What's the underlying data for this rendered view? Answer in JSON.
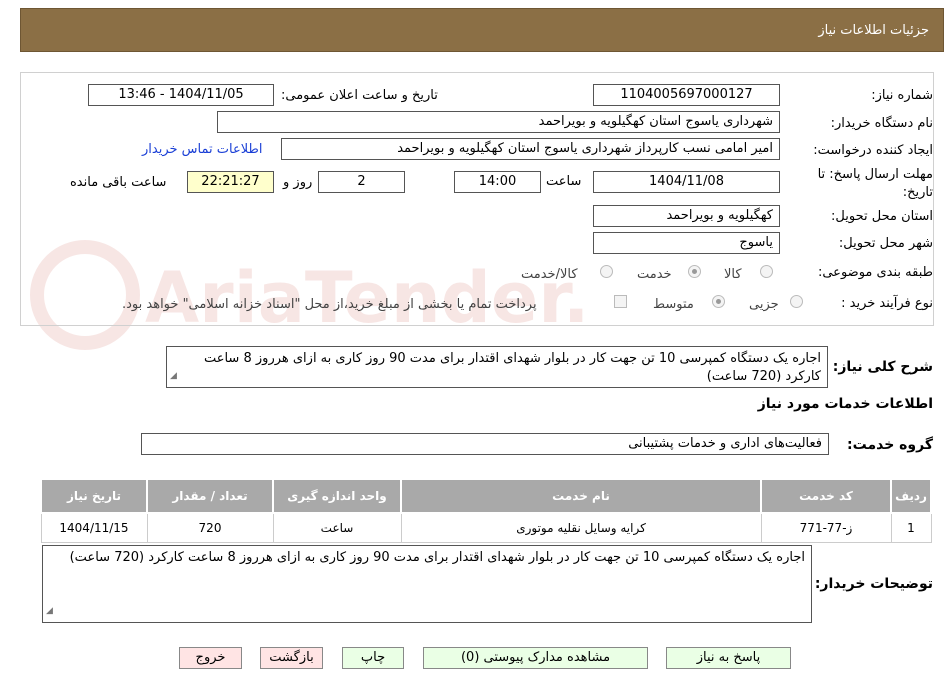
{
  "header": {
    "title": "جزئیات اطلاعات نیاز"
  },
  "watermark": "AriaTender.neT",
  "form": {
    "need_number_label": "شماره نیاز:",
    "need_number": "1104005697000127",
    "announce_label": "تاریخ و ساعت اعلان عمومی:",
    "announce_value": "1404/11/05 - 13:46",
    "buyer_org_label": "نام دستگاه خریدار:",
    "buyer_org": "شهرداری یاسوج استان کهگیلویه و بویراحمد",
    "creator_label": "ایجاد کننده درخواست:",
    "creator": "امیر امامی نسب کارپرداز شهرداری یاسوج استان کهگیلویه و بویراحمد",
    "contact_link": "اطلاعات تماس خریدار",
    "deadline_label_1": "مهلت ارسال پاسخ: تا",
    "deadline_label_2": "تاریخ:",
    "deadline_date": "1404/11/08",
    "hour_label": "ساعت",
    "deadline_hour": "14:00",
    "days_value": "2",
    "days_label": "روز و",
    "remaining_time": "22:21:27",
    "remaining_label": "ساعت باقی مانده",
    "province_label": "استان محل تحویل:",
    "province": "کهگیلویه و بویراحمد",
    "city_label": "شهر محل تحویل:",
    "city": "یاسوج",
    "category_label": "طبقه بندی موضوعی:",
    "category_options": [
      "کالا",
      "خدمت",
      "کالا/خدمت"
    ],
    "category_selected": "خدمت",
    "process_label": "نوع فرآیند خرید :",
    "process_options": [
      "جزیی",
      "متوسط"
    ],
    "process_selected": "متوسط",
    "payment_note": "پرداخت تمام یا بخشی از مبلغ خرید،از محل \"اسناد خزانه اسلامی\" خواهد بود."
  },
  "summary": {
    "label": "شرح کلی نیاز:",
    "text": "اجاره یک دستگاه کمپرسی 10 تن جهت کار در بلوار شهدای اقتدار برای مدت 90 روز کاری به ازای هرروز 8 ساعت کارکرد (720 ساعت)"
  },
  "services": {
    "section_title": "اطلاعات خدمات مورد نیاز",
    "group_label": "گروه خدمت:",
    "group_value": "فعالیت‌های اداری و خدمات پشتیبانی",
    "columns": [
      "ردیف",
      "کد خدمت",
      "نام خدمت",
      "واحد اندازه گیری",
      "تعداد / مقدار",
      "تاریخ نیاز"
    ],
    "rows": [
      [
        "1",
        "ز-77-771",
        "کرایه وسایل نقلیه موتوری",
        "ساعت",
        "720",
        "1404/11/15"
      ]
    ]
  },
  "buyer_notes": {
    "label": "توضیحات خریدار:",
    "text": "اجاره یک دستگاه کمپرسی 10 تن جهت کار در بلوار شهدای اقتدار برای مدت 90 روز کاری به ازای هرروز 8 ساعت کارکرد (720 ساعت)"
  },
  "buttons": {
    "reply": "پاسخ به نیاز",
    "attachments": "مشاهده مدارک پیوستی (0)",
    "print": "چاپ",
    "back": "بازگشت",
    "exit": "خروج"
  }
}
